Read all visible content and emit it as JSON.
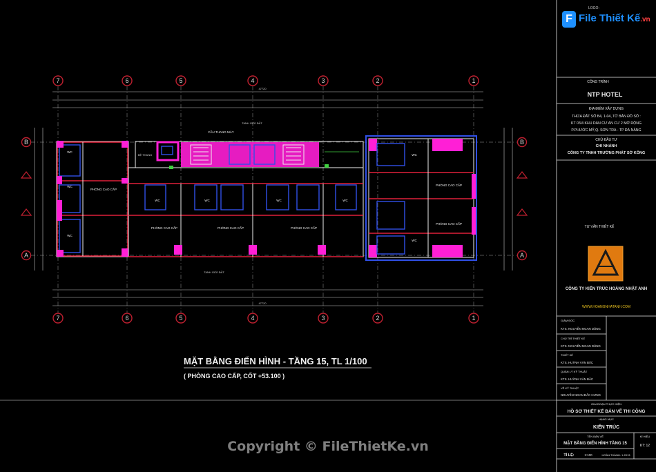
{
  "logo": {
    "mark": "F",
    "brand": "File Thiết Kế",
    "tld": ".vn",
    "top_label": "LOGO:"
  },
  "grid_columns": [
    "7",
    "6",
    "5",
    "4",
    "3",
    "2",
    "1"
  ],
  "grid_rows": [
    "B",
    "A"
  ],
  "side_rows_left": [
    "B",
    "A"
  ],
  "side_rows_right": [
    "B",
    "A"
  ],
  "plan": {
    "street_top": "TANH GIỚI ĐẤT",
    "street_bottom": "TANH GIỚI ĐẤT",
    "room_label": "PHÒNG CAO CẤP",
    "wc_label": "WC",
    "elevator_label": "CẦU THANG MÁY",
    "level_left": "BỆ THANG",
    "total_dim": "47720"
  },
  "drawing_title": {
    "main": "MẶT BẰNG ĐIỂN HÌNH - TẦNG 15,  TL 1/100",
    "sub": "( PHÒNG CAO CẤP, CỐT +53.100 )"
  },
  "title_block": {
    "project_label": "CÔNG TRÌNH",
    "project_name": "NTP HOTEL",
    "location_label": "ĐỊA ĐIỂM XÂY DỰNG",
    "location_lines": [
      "THỬA ĐẤT SỐ B4, 1-04, TỜ BẢN ĐỒ SỐ :",
      "KT 03/4 KHU DÂN CƯ AN CƯ 2 MỞ RỘNG",
      "P.PHƯỚC MỸ,Q. SƠN TRÀ - TP ĐÀ NẴNG"
    ],
    "investor_label": "CHỦ ĐẦU TƯ",
    "investor_lines": [
      "CHI NHÁNH",
      "CÔNG TY TNHH TRƯỜNG PHÁT SỞ KÔNG"
    ],
    "consultant_label": "TƯ VẤN THIẾT KẾ",
    "company_name": "CÔNG TY KIẾN TRÚC HOÀNG NHẬT ANH",
    "company_web": "WWW.HOANGNHATANH.COM",
    "roles": [
      {
        "label": "GIÁM ĐỐC",
        "name": "KTS. NGUYỄN NGAN DŨNG"
      },
      {
        "label": "CHỦ TRÌ THIẾT KẾ",
        "name": "KTS. NGUYỄN NGAN DŨNG"
      },
      {
        "label": "THIẾT KẾ",
        "name": "KTS. HUỲNH VĂN BẮC"
      },
      {
        "label": "QUẢN LÝ KỸ THUẬT",
        "name": "KTS. HUỲNH VĂN BẮC"
      },
      {
        "label": "VẼ KỸ THUẬT",
        "name": "NGUYỄN NGAN ĐẮC HƯNG"
      }
    ],
    "phase_label": "GIAI ĐOẠN THỰC HIỆN",
    "phase": "HỒ SƠ THIẾT KẾ BẢN VẼ THI CÔNG",
    "category_label": "HẠNG MỤC",
    "category": "KIẾN TRÚC",
    "sheet_label": "TÊN BẢN VẼ",
    "sheet_name": "MẶT BẰNG ĐIỂN HÌNH TẦNG 15",
    "sheet_no_label": "KÍ HIỆU",
    "sheet_no": "KT: 12",
    "scale_label": "TỈ LỆ:",
    "scale": "1:100",
    "date_label": "HOÀN THÀNH: 1-2013"
  },
  "copyright": "Copyright © FileThietKe.vn"
}
